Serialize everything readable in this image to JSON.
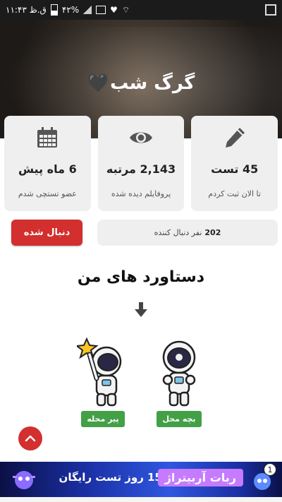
{
  "status_bar": {
    "time": "۱۱:۴۳ ق.ظ",
    "battery": "۴۲%"
  },
  "profile": {
    "name": "گرگ شب",
    "heart": "🖤"
  },
  "stats": [
    {
      "value": "45 تست",
      "label": "تا الان ثبت کردم",
      "icon": "pencil-icon"
    },
    {
      "value": "2,143 مرتبه",
      "label": "پروفایلم دیده شده",
      "icon": "eye-icon"
    },
    {
      "value": "6 ماه پیش",
      "label": "عضو تستچی شدم",
      "icon": "calendar-icon"
    }
  ],
  "followers": {
    "count": "202",
    "text": "نفر دنبال کننده"
  },
  "follow_button": {
    "label": "دنبال شده"
  },
  "achievements": {
    "title": "دستاورد های من",
    "items": [
      {
        "label": "بچه محل",
        "icon": "astronaut-icon"
      },
      {
        "label": "پیر محله",
        "icon": "astronaut-star-icon"
      }
    ]
  },
  "banner": {
    "brand": "ربات آربیتراژ",
    "offer": "15 روز تست رایگان",
    "badge_number": "1"
  },
  "colors": {
    "primary_red": "#d32f2f",
    "badge_green": "#43a047",
    "card_bg": "#efefef"
  }
}
